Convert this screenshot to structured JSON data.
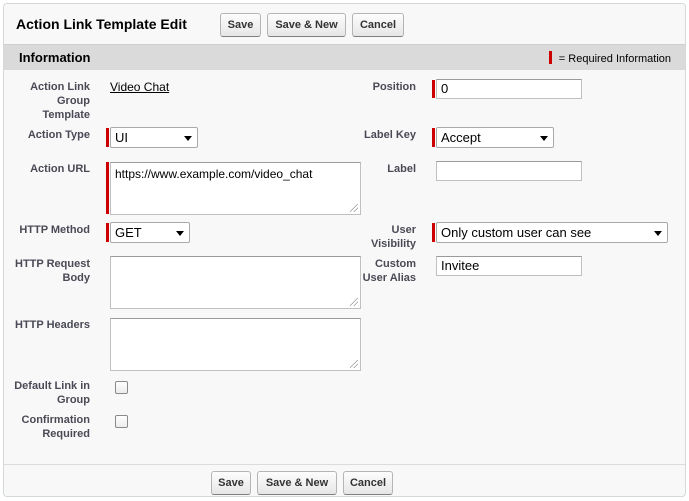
{
  "page": {
    "title": "Action Link Template Edit",
    "buttons": {
      "save": "Save",
      "save_new": "Save & New",
      "cancel": "Cancel"
    }
  },
  "section": {
    "title": "Information",
    "required_legend": "= Required Information"
  },
  "fields": {
    "group_template": {
      "label": "Action Link Group Template",
      "value": "Video Chat"
    },
    "action_type": {
      "label": "Action Type",
      "value": "UI"
    },
    "action_url": {
      "label": "Action URL",
      "value": "https://www.example.com/video_chat"
    },
    "http_method": {
      "label": "HTTP Method",
      "value": "GET"
    },
    "http_request_body": {
      "label": "HTTP Request Body",
      "value": ""
    },
    "http_headers": {
      "label": "HTTP Headers",
      "value": ""
    },
    "default_link": {
      "label": "Default Link in Group",
      "checked": false
    },
    "confirmation_required": {
      "label": "Confirmation Required",
      "checked": false
    },
    "position": {
      "label": "Position",
      "value": "0"
    },
    "label_key": {
      "label": "Label Key",
      "value": "Accept"
    },
    "label": {
      "label": "Label",
      "value": ""
    },
    "user_visibility": {
      "label": "User Visibility",
      "value": "Only custom user can see"
    },
    "custom_user_alias": {
      "label": "Custom User Alias",
      "value": "Invitee"
    }
  },
  "colors": {
    "required": "#cc0000",
    "section_bg": "#dadada",
    "page_bg": "#f8f8f8"
  }
}
